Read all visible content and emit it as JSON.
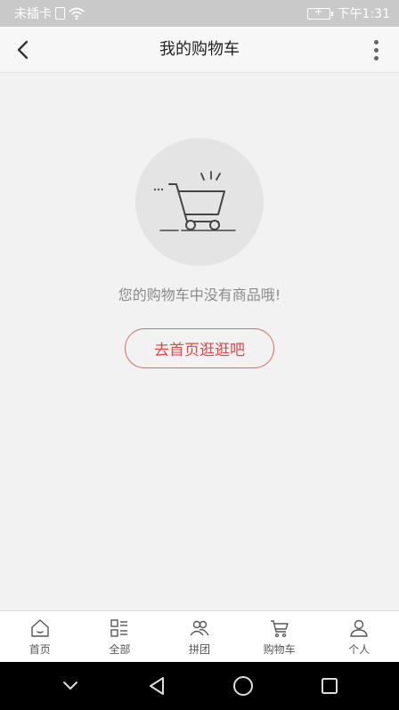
{
  "status_bar": {
    "carrier": "未插卡",
    "time": "下午1:31"
  },
  "header": {
    "title": "我的购物车",
    "back_icon": "chevron-left-icon",
    "more_icon": "more-vertical-icon"
  },
  "empty_state": {
    "illustration_icon": "shopping-cart-icon",
    "message": "您的购物车中没有商品哦!",
    "button_label": "去首页逛逛吧"
  },
  "tabs": [
    {
      "label": "首页",
      "icon": "home-icon"
    },
    {
      "label": "全部",
      "icon": "category-icon"
    },
    {
      "label": "拼团",
      "icon": "group-icon"
    },
    {
      "label": "购物车",
      "icon": "cart-icon"
    },
    {
      "label": "个人",
      "icon": "user-icon"
    }
  ],
  "colors": {
    "accent": "#d94a4a",
    "background": "#f2f2f2",
    "status_bar": "#c9c9c9"
  }
}
